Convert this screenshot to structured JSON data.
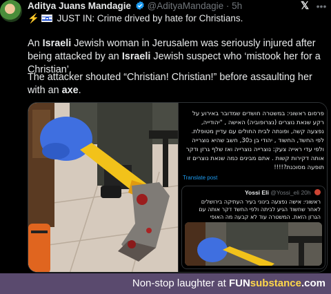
{
  "tweet": {
    "display_name": "Aditya Juans Mandagie",
    "handle": "@AdityaMandagie",
    "separator": "·",
    "time": "5h",
    "headline": "JUST IN: Crime drived by hate for Christians.",
    "para1": {
      "a": "An ",
      "b1": "Israeli",
      "c": " Jewish woman in Jerusalem was seriously injured after being attacked by an ",
      "b2": "Israeli",
      "d": " Jewish suspect who ‘mistook her for a Christian’."
    },
    "para2": {
      "a": "The attacker shouted “Christian! Christian!” before assaulting her with an ",
      "b": "axe",
      "c": "."
    }
  },
  "embedded_post": {
    "hebrew_text": "פרסום ראשוני: במשטרה חושדים שמדובר באירוע על רקע שנאת נוצרים (נצרופוביה) האישה , \"יהודייה, נפצעה קשה, ופונתה לבית החולים עם עדיין מטופלת. לפי החשד, החשוד , יהודי בן כ30, חשב שהיא נוצרייה ולפי עדי ראייה צעק: נוצרייה נוצרייה ואז שלף גרזן ודקר אותה דקירות קשות . אתם מבינים כמה שנאת נוצרים זו תופעה מסוכנת?!!!!",
    "translate_label": "Translate post",
    "quoted": {
      "name": "Yossi Eli",
      "handle": "@Yossi_eli",
      "time": "20h",
      "text": "ראשוני: אישה נפצעה בינוני בעיר העתיקה בירושלים לאחר שחשוד הגיע לביתה ולפי החשד דקר אותה עם הגרזן הזאת. המשטרה עוד לא קבעה מה האופי"
    }
  },
  "footer": {
    "text": "Non-stop laughter at ",
    "brand_a": "FUN",
    "brand_b": "substance",
    "brand_c": ".com"
  },
  "colors": {
    "background": "#000000",
    "footer_bg": "#5a4a6e",
    "link": "#1d9bf0",
    "muted": "#71767b"
  },
  "icons": [
    "verified-badge-icon",
    "x-logo-icon",
    "more-icon",
    "lightning-icon",
    "israel-flag-icon"
  ]
}
